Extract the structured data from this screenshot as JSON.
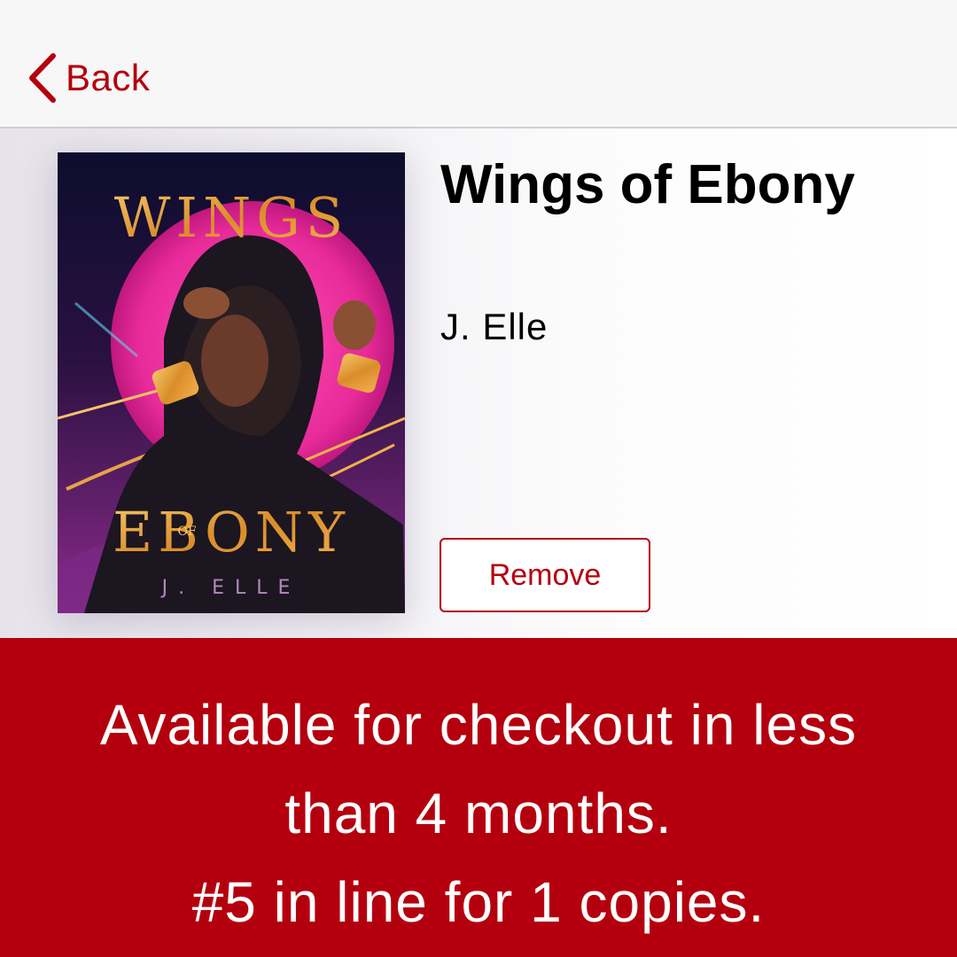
{
  "navbar": {
    "back_label": "Back",
    "back_icon": "chevron-left-icon",
    "accent_color": "#b5000d"
  },
  "book": {
    "title": "Wings of Ebony",
    "author": "J. Elle",
    "cover": {
      "title_top": "WINGS",
      "title_mid": "OF",
      "title_bottom": "EBONY",
      "author": "J. ELLE"
    }
  },
  "actions": {
    "remove_label": "Remove"
  },
  "hold_status": {
    "line1": "Available for checkout in less",
    "line2": "than 4 months.",
    "line3": "#5 in line for 1 copies.",
    "background_color": "#b4000e"
  }
}
